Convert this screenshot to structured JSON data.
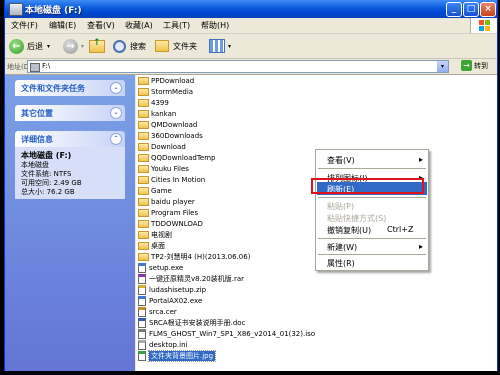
{
  "window": {
    "title": "本地磁盘 (F:)",
    "controls": {
      "minimize": "_",
      "maximize": "□",
      "close": "×"
    }
  },
  "menubar": {
    "items": [
      "文件(F)",
      "编辑(E)",
      "查看(V)",
      "收藏(A)",
      "工具(T)",
      "帮助(H)"
    ]
  },
  "toolbar": {
    "back_label": "后退",
    "search_label": "搜索",
    "folders_label": "文件夹"
  },
  "address": {
    "label": "地址(D)",
    "value": "F:\\",
    "go_label": "转到"
  },
  "left_pane": {
    "tasks_title": "文件和文件夹任务",
    "other_title": "其它位置",
    "details_title": "详细信息",
    "details": {
      "name": "本地磁盘 (F:)",
      "type": "本地磁盘",
      "fs_label": "文件系统: NTFS",
      "free_label": "可用空间: 2.49 GB",
      "total_label": "总大小: 76.2 GB"
    }
  },
  "files": [
    {
      "name": "PPDownload",
      "kind": "folder"
    },
    {
      "name": "StormMedia",
      "kind": "folder"
    },
    {
      "name": "4399",
      "kind": "folder"
    },
    {
      "name": "kankan",
      "kind": "folder"
    },
    {
      "name": "QMDownload",
      "kind": "folder"
    },
    {
      "name": "360Downloads",
      "kind": "folder"
    },
    {
      "name": "Download",
      "kind": "folder"
    },
    {
      "name": "QQDownloadTemp",
      "kind": "folder"
    },
    {
      "name": "Youku Files",
      "kind": "folder"
    },
    {
      "name": "Cities In Motion",
      "kind": "folder"
    },
    {
      "name": "Game",
      "kind": "folder"
    },
    {
      "name": "baidu player",
      "kind": "folder"
    },
    {
      "name": "Program Files",
      "kind": "folder"
    },
    {
      "name": "TDDOWNLOAD",
      "kind": "folder"
    },
    {
      "name": "电视剧",
      "kind": "folder"
    },
    {
      "name": "桌面",
      "kind": "folder"
    },
    {
      "name": "TP2-刘慧明4 (H)(2013.06.06)",
      "kind": "folder"
    },
    {
      "name": "setup.exe",
      "kind": "exe"
    },
    {
      "name": "一键还原精灵v8.20装机版.rar",
      "kind": "rar"
    },
    {
      "name": "ludashisetup.zip",
      "kind": "zip"
    },
    {
      "name": "PortalAX02.exe",
      "kind": "exe"
    },
    {
      "name": "srca.cer",
      "kind": "cer"
    },
    {
      "name": "SRCA根证书安装说明手册.doc",
      "kind": "doc"
    },
    {
      "name": "FLMS_GHOST_Win7_SP1_X86_v2014_01(32).iso",
      "kind": "iso"
    },
    {
      "name": "desktop.ini",
      "kind": "ini"
    },
    {
      "name": "文件夹背景图片.jpg",
      "kind": "jpg",
      "selected": true
    }
  ],
  "context_menu": {
    "items": [
      {
        "label": "查看(V)",
        "arrow": "▸"
      },
      {
        "label": "排列图标(I)",
        "arrow": "▸"
      },
      {
        "label": "刷新(E)",
        "highlighted": true
      },
      {
        "label": "粘贴(P)",
        "disabled": true
      },
      {
        "label": "粘贴快捷方式(S)",
        "disabled": true
      },
      {
        "label": "撤销复制(U)",
        "shortcut": "Ctrl+Z"
      },
      {
        "label": "新建(W)",
        "arrow": "▸"
      },
      {
        "label": "属性(R)"
      }
    ]
  },
  "colors": {
    "title_bar": "#0A5BDB",
    "left_pane": "#7BA2E7",
    "selection": "#316AC5",
    "annotation_red": "#E0131C"
  }
}
